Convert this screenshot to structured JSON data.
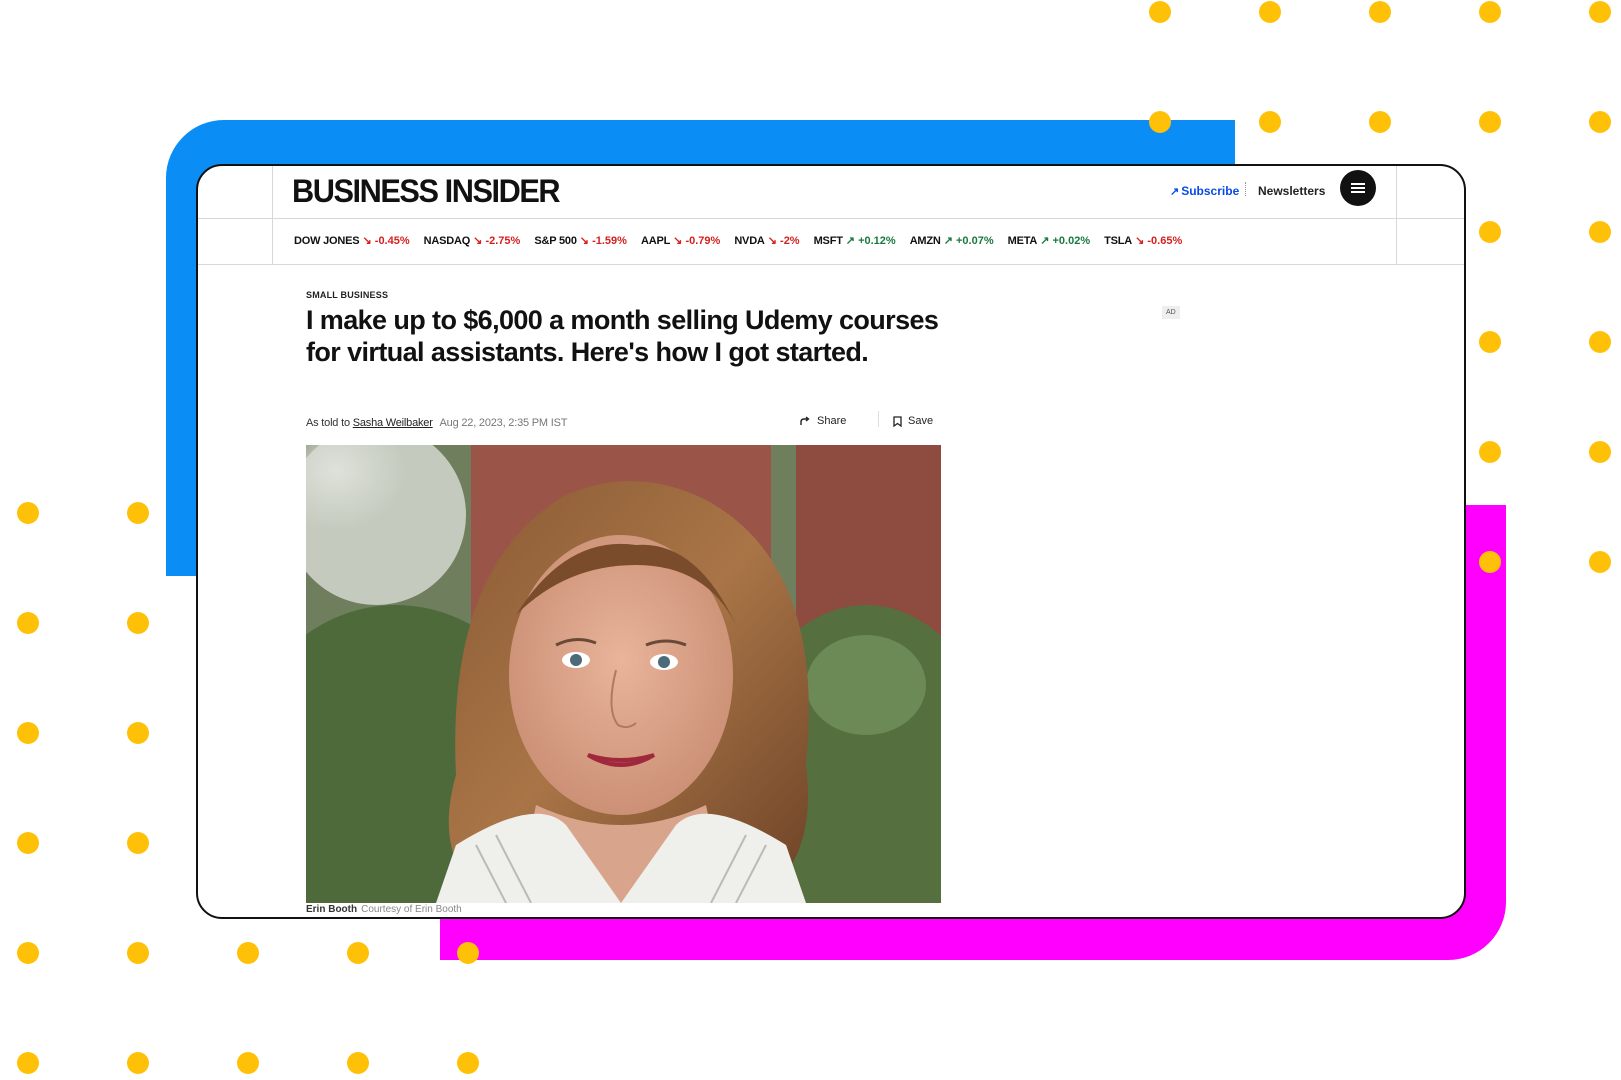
{
  "site": {
    "logo": "BUSINESS INSIDER",
    "subscribe_label": "Subscribe",
    "newsletters_label": "Newsletters"
  },
  "ticker": [
    {
      "symbol": "DOW JONES",
      "change": "-0.45%",
      "direction": "down"
    },
    {
      "symbol": "NASDAQ",
      "change": "-2.75%",
      "direction": "down"
    },
    {
      "symbol": "S&P 500",
      "change": "-1.59%",
      "direction": "down"
    },
    {
      "symbol": "AAPL",
      "change": "-0.79%",
      "direction": "down"
    },
    {
      "symbol": "NVDA",
      "change": "-2%",
      "direction": "down"
    },
    {
      "symbol": "MSFT",
      "change": "+0.12%",
      "direction": "up"
    },
    {
      "symbol": "AMZN",
      "change": "+0.07%",
      "direction": "up"
    },
    {
      "symbol": "META",
      "change": "+0.02%",
      "direction": "up"
    },
    {
      "symbol": "TSLA",
      "change": "-0.65%",
      "direction": "down"
    }
  ],
  "article": {
    "category": "SMALL BUSINESS",
    "headline": "I make up to $6,000 a month selling Udemy courses for virtual assistants. Here's how I got started.",
    "byline_prefix": "As told to",
    "author": "Sasha Weilbaker",
    "date": "Aug 22, 2023, 2:35 PM IST",
    "share_label": "Share",
    "save_label": "Save",
    "ad_label": "AD",
    "caption_name": "Erin Booth",
    "caption_credit": "Courtesy of Erin Booth"
  },
  "colors": {
    "accent_blue": "#0a8ef5",
    "accent_magenta": "#ff00ff",
    "dot_yellow": "#ffc107",
    "ticker_down": "#d61f1f",
    "ticker_up": "#1a7a3b",
    "subscribe_blue": "#0a4ae8"
  }
}
